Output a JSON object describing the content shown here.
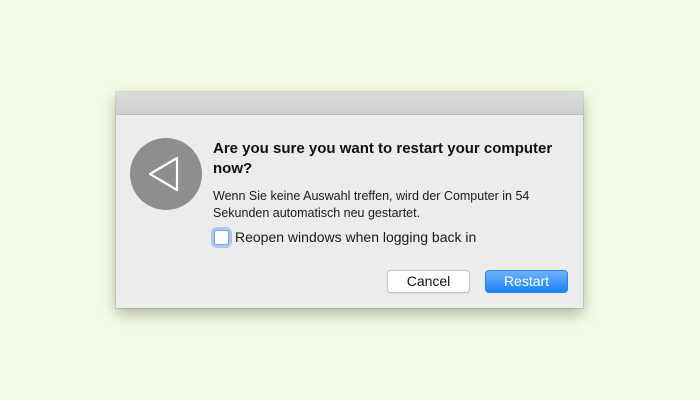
{
  "dialog": {
    "headline": "Are you sure you want to restart your computer now?",
    "message": "Wenn Sie keine Auswahl treffen, wird der Computer in 54 Sekunden automatisch neu gestartet.",
    "checkbox": {
      "label": "Reopen windows when logging back in",
      "checked": false
    },
    "buttons": {
      "cancel_label": "Cancel",
      "restart_label": "Restart"
    },
    "icon": "restart-triangle-icon"
  },
  "colors": {
    "background": "#f2fbe6",
    "dialog": "#ececec",
    "primary_button": "#1b83f5",
    "icon_circle": "#8e8e8e"
  }
}
